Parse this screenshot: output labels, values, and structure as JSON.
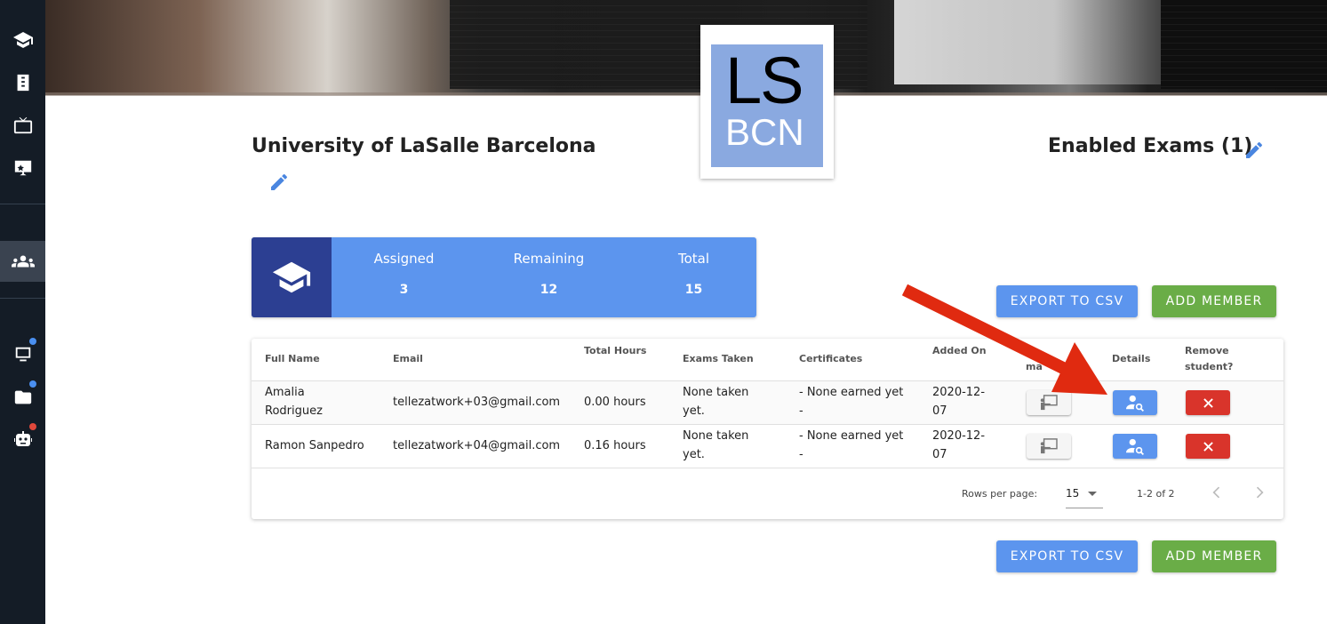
{
  "sidebar": {
    "items": [
      {
        "icon": "graduation-cap-icon"
      },
      {
        "icon": "document-icon"
      },
      {
        "icon": "tv-icon"
      },
      {
        "icon": "presentation-icon"
      },
      {
        "icon": "group-icon",
        "active": true
      },
      {
        "icon": "monitor-icon",
        "badge_color": "#4a8ff0"
      },
      {
        "icon": "folder-icon",
        "badge_color": "#4a8ff0"
      },
      {
        "icon": "robot-icon",
        "badge_color": "#e0483b"
      }
    ]
  },
  "logo": {
    "line1": "LS",
    "line2": "BCN"
  },
  "org": {
    "name": "University of LaSalle Barcelona"
  },
  "exams": {
    "title": "Enabled Exams (1)"
  },
  "stats": {
    "assigned": {
      "label": "Assigned",
      "value": "3"
    },
    "remaining": {
      "label": "Remaining",
      "value": "12"
    },
    "total": {
      "label": "Total",
      "value": "15"
    }
  },
  "actions": {
    "export_label": "EXPORT TO CSV",
    "add_label": "ADD MEMBER"
  },
  "table": {
    "headers": {
      "full_name": "Full Name",
      "email": "Email",
      "total_hours": "Total Hours",
      "exams_taken": "Exams Taken",
      "certificates": "Certificates",
      "added_on": "Added On",
      "manage_partial": "ma",
      "details": "Details",
      "remove_line1": "Remove",
      "remove_line2": "student?"
    },
    "rows": [
      {
        "name_line1": "Amalia",
        "name_line2": "Rodriguez",
        "email": "tellezatwork+03@gmail.com",
        "hours": "0.00 hours",
        "exams_line1": "None taken",
        "exams_line2": "yet.",
        "cert_line1": "- None earned yet",
        "cert_line2": "-",
        "added_line1": "2020-12-",
        "added_line2": "07"
      },
      {
        "name_line1": "Ramon Sanpedro",
        "name_line2": "",
        "email": "tellezatwork+04@gmail.com",
        "hours": "0.16 hours",
        "exams_line1": "None taken",
        "exams_line2": "yet.",
        "cert_line1": "- None earned yet",
        "cert_line2": "-",
        "added_line1": "2020-12-",
        "added_line2": "07"
      }
    ],
    "footer": {
      "rows_per_page_label": "Rows per page:",
      "rows_per_page_value": "15",
      "range": "1-2 of 2"
    }
  },
  "colors": {
    "primary": "#5c95ee",
    "success": "#6aad47",
    "danger": "#d9342b",
    "annotation_arrow": "#e02a10"
  }
}
